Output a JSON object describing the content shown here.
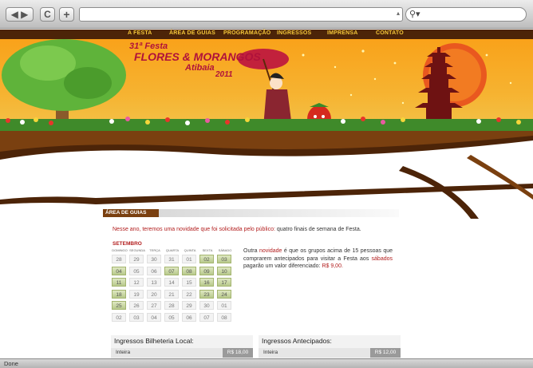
{
  "browser": {
    "nav_arrows": "◀ ▶",
    "reload": "C",
    "add": "+",
    "address": "",
    "search_icon": "⚲▾",
    "status": "Done"
  },
  "site_nav": [
    "A FESTA",
    "ÁREA DE GUIAS",
    "PROGRAMAÇÃO",
    "INGRESSOS",
    "IMPRENSA",
    "CONTATO"
  ],
  "banner": {
    "line1": "31ª Festa",
    "line2": "FLORES & MORANGOS",
    "line3": "Atibaia",
    "line4": "2011"
  },
  "section": {
    "title": "ÁREA DE GUIAS"
  },
  "intro": {
    "red": "Nesse ano, teremos uma novidade que foi solicitada pelo público:",
    "rest": " quatro finais de semana de Festa."
  },
  "calendar": {
    "month": "SETEMBRO",
    "weekdays": [
      "DOMINGO",
      "SEGUNDA",
      "TERÇA",
      "QUARTA",
      "QUINTA",
      "SEXTA",
      "SÁBADO"
    ],
    "weeks": [
      [
        "28",
        "29",
        "30",
        "31",
        "01",
        "02",
        "03"
      ],
      [
        "04",
        "05",
        "06",
        "07",
        "08",
        "09",
        "10"
      ],
      [
        "11",
        "12",
        "13",
        "14",
        "15",
        "16",
        "17"
      ],
      [
        "18",
        "19",
        "20",
        "21",
        "22",
        "23",
        "24"
      ],
      [
        "25",
        "26",
        "27",
        "28",
        "29",
        "30",
        "01"
      ],
      [
        "02",
        "03",
        "04",
        "05",
        "06",
        "07",
        "08"
      ]
    ],
    "highlighted": [
      "0-5",
      "0-6",
      "1-0",
      "1-3",
      "1-4",
      "1-5",
      "1-6",
      "2-0",
      "2-5",
      "2-6",
      "3-0",
      "3-5",
      "3-6",
      "4-0"
    ]
  },
  "side_note": {
    "p1": "Outra ",
    "novidade": "novidade",
    "p2": " é que os grupos acima de 15 pessoas que comprarem antecipados para visitar a Festa aos ",
    "sabados": "sábados",
    "p3": " pagarão um valor diferenciado: ",
    "price": "R$ 9,00."
  },
  "tickets": [
    {
      "title": "Ingressos Bilheteria Local:",
      "label": "Inteira",
      "price": "R$ 18,00"
    },
    {
      "title": "Ingressos Antecipados:",
      "label": "Inteira",
      "price": "R$ 12,00"
    }
  ],
  "colors": {
    "brown": "#4c2408",
    "orange": "#f6a623",
    "gold": "#f3c63b",
    "red": "#b21d1d"
  }
}
